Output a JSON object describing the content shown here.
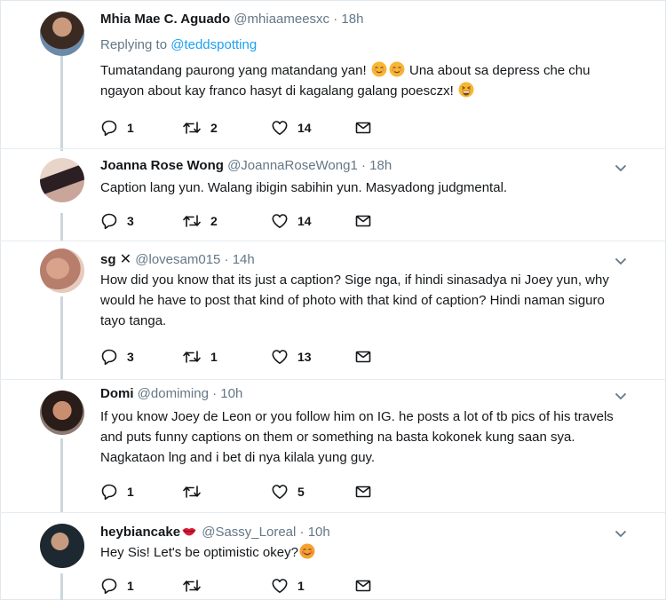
{
  "tweets": [
    {
      "name": "Mhia Mae C. Aguado",
      "handle": "@mhiaameesxc",
      "time": "18h",
      "replying_prefix": "Replying to",
      "replying_to": "@teddspotting",
      "text_1": "Tumatandang paurong yang matandang yan! ",
      "text_2": " Una about sa depress che chu  ngayon about kay franco hasyt di kagalang galang poesczx! ",
      "replies": "1",
      "retweets": "2",
      "likes": "14"
    },
    {
      "name": "Joanna Rose Wong",
      "handle": "@JoannaRoseWong1",
      "time": "18h",
      "text": "Caption lang yun. Walang ibigin sabihin yun. Masyadong judgmental.",
      "replies": "3",
      "retweets": "2",
      "likes": "14"
    },
    {
      "name": "sg",
      "name_badge": "✕",
      "handle": "@lovesam015",
      "time": "14h",
      "text": "How did you know that its just a caption? Sige nga, if hindi sinasadya ni Joey yun, why would he have to post that kind of photo with that kind of caption? Hindi naman siguro tayo tanga.",
      "replies": "3",
      "retweets": "1",
      "likes": "13"
    },
    {
      "name": "Domi",
      "handle": "@domiming",
      "time": "10h",
      "text": "If you know Joey de Leon or you follow him on IG. he posts a lot of tb pics of his travels and puts funny captions on them or something na basta kokonek kung saan sya. Nagkataon lng and i bet di nya kilala yung guy.",
      "replies": "1",
      "retweets": "",
      "likes": "5"
    },
    {
      "name": "heybiancake",
      "handle": "@Sassy_Loreal",
      "time": "10h",
      "text": "Hey Sis! Let's be optimistic okey?",
      "replies": "1",
      "retweets": "",
      "likes": "1"
    }
  ],
  "separator": "·",
  "icons": {
    "reply": "reply-icon",
    "retweet": "retweet-icon",
    "like": "heart-icon",
    "dm": "envelope-icon",
    "more": "chevron-down-icon",
    "emoji_relieved": "relieved-face-emoji",
    "emoji_laugh": "grinning-squinting-face-emoji",
    "emoji_blush": "smiling-face-emoji",
    "emoji_lips": "lips-emoji"
  },
  "colors": {
    "name": "#14171a",
    "muted": "#657786",
    "link": "#1da1f2",
    "thread": "#ccd6dd",
    "separator": "#e6ecf0"
  }
}
